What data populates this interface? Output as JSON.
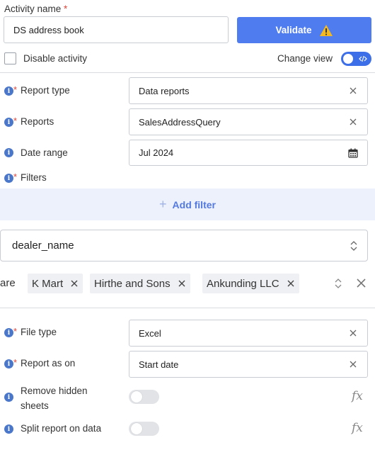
{
  "activity": {
    "label": "Activity name",
    "required_mark": "*",
    "value": "DS address book"
  },
  "validate_button": {
    "label": "Validate",
    "warning_icon": "warning-icon",
    "color": "#4f7df0"
  },
  "disable_activity": {
    "label": "Disable activity",
    "checked": false
  },
  "change_view": {
    "label": "Change view",
    "enabled": true
  },
  "fields": {
    "report_type": {
      "label": "Report type",
      "value": "Data reports"
    },
    "reports": {
      "label": "Reports",
      "value": "SalesAddressQuery"
    },
    "date_range": {
      "label": "Date range",
      "value": "Jul 2024"
    },
    "filters": {
      "label": "Filters"
    },
    "file_type": {
      "label": "File type",
      "value": "Excel"
    },
    "report_as_on": {
      "label": "Report as on",
      "value": "Start date"
    },
    "remove_hidden_sheets": {
      "label_line1": "Remove hidden",
      "label_line2": "sheets",
      "enabled": false
    },
    "split_report": {
      "label": "Split report on data",
      "enabled": false
    }
  },
  "add_filter": {
    "label": "Add filter"
  },
  "filter": {
    "field": "dealer_name",
    "operator_fragment": "are",
    "values": [
      "K Mart",
      "Hirthe and Sons",
      "Ankunding LLC"
    ]
  },
  "fx_label": "fx",
  "colors": {
    "accent": "#4f7df0",
    "required": "#e0453b",
    "info": "#4a77c9",
    "add_filter_bg": "#ecf1fc"
  }
}
